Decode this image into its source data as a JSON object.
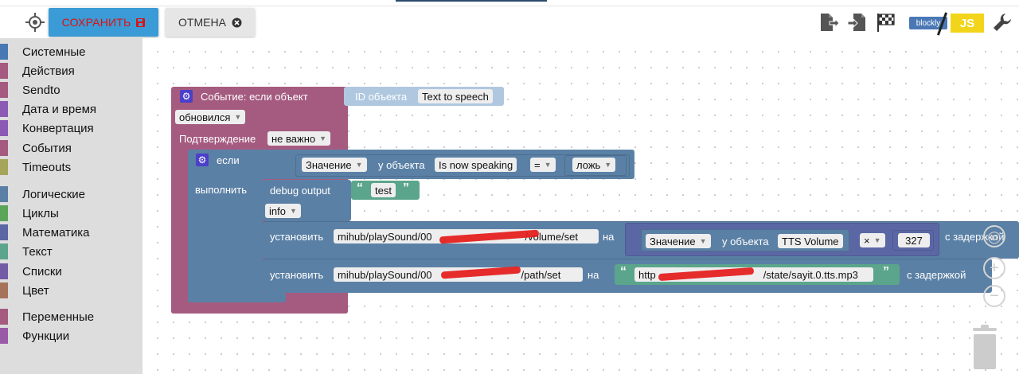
{
  "toolbar": {
    "save_label": "СОХРАНИТЬ",
    "cancel_label": "ОТМЕНА",
    "blockly_label": "blockly",
    "js_label": "JS",
    "icons": [
      "target-icon",
      "export-icon",
      "import-icon",
      "checkered-flag-icon",
      "blockly-js-toggle",
      "wrench-icon"
    ]
  },
  "sidebar": {
    "categories": [
      {
        "label": "Системные",
        "color": "#4a78b5"
      },
      {
        "label": "Действия",
        "color": "#a55b80"
      },
      {
        "label": "Sendto",
        "color": "#a55b80"
      },
      {
        "label": "Дата и время",
        "color": "#8c5ab5"
      },
      {
        "label": "Конвертация",
        "color": "#8c5ab5"
      },
      {
        "label": "События",
        "color": "#a55b80"
      },
      {
        "label": "Timeouts",
        "color": "#a5a55b"
      },
      {
        "label": "Логические",
        "color": "#5b80a5"
      },
      {
        "label": "Циклы",
        "color": "#5ba55b"
      },
      {
        "label": "Математика",
        "color": "#5b67a5"
      },
      {
        "label": "Текст",
        "color": "#5ba58c"
      },
      {
        "label": "Списки",
        "color": "#745ba5"
      },
      {
        "label": "Цвет",
        "color": "#a5745b"
      },
      {
        "label": "Переменные",
        "color": "#a55b80"
      },
      {
        "label": "Функции",
        "color": "#995ba5"
      }
    ]
  },
  "workspace": {
    "event": {
      "title": "Событие: если объект",
      "id_label": "ID объекта",
      "id_value": "Text to speech",
      "trigger": "обновился",
      "ack_label": "Подтверждение",
      "ack_value": "не важно"
    },
    "if_block": {
      "if_label": "если",
      "do_label": "выполнить",
      "value_dd": "Значение",
      "of_object": "у объекта",
      "object": "Is now speaking",
      "op": "=",
      "bool": "ложь"
    },
    "debug": {
      "label": "debug output",
      "text": "test",
      "level": "info"
    },
    "set1": {
      "label": "установить",
      "path": "mihub/playSound/00",
      "path_end": "/volume/set",
      "on": "на",
      "value_dd": "Значение",
      "of_object": "у объекта",
      "object": "TTS Volume",
      "op": "×",
      "num": "327",
      "delay": "с задержкой"
    },
    "set2": {
      "label": "установить",
      "path": "mihub/playSound/00",
      "path_end": "/path/set",
      "on": "на",
      "url_start": "http",
      "url_end": "/state/sayit.0.tts.mp3",
      "delay": "с задержкой"
    },
    "colors": {
      "event": "#a55b80",
      "logic": "#5b80a5",
      "action": "#5b80a5",
      "text": "#5ba58c",
      "math": "#5b67a5"
    }
  }
}
